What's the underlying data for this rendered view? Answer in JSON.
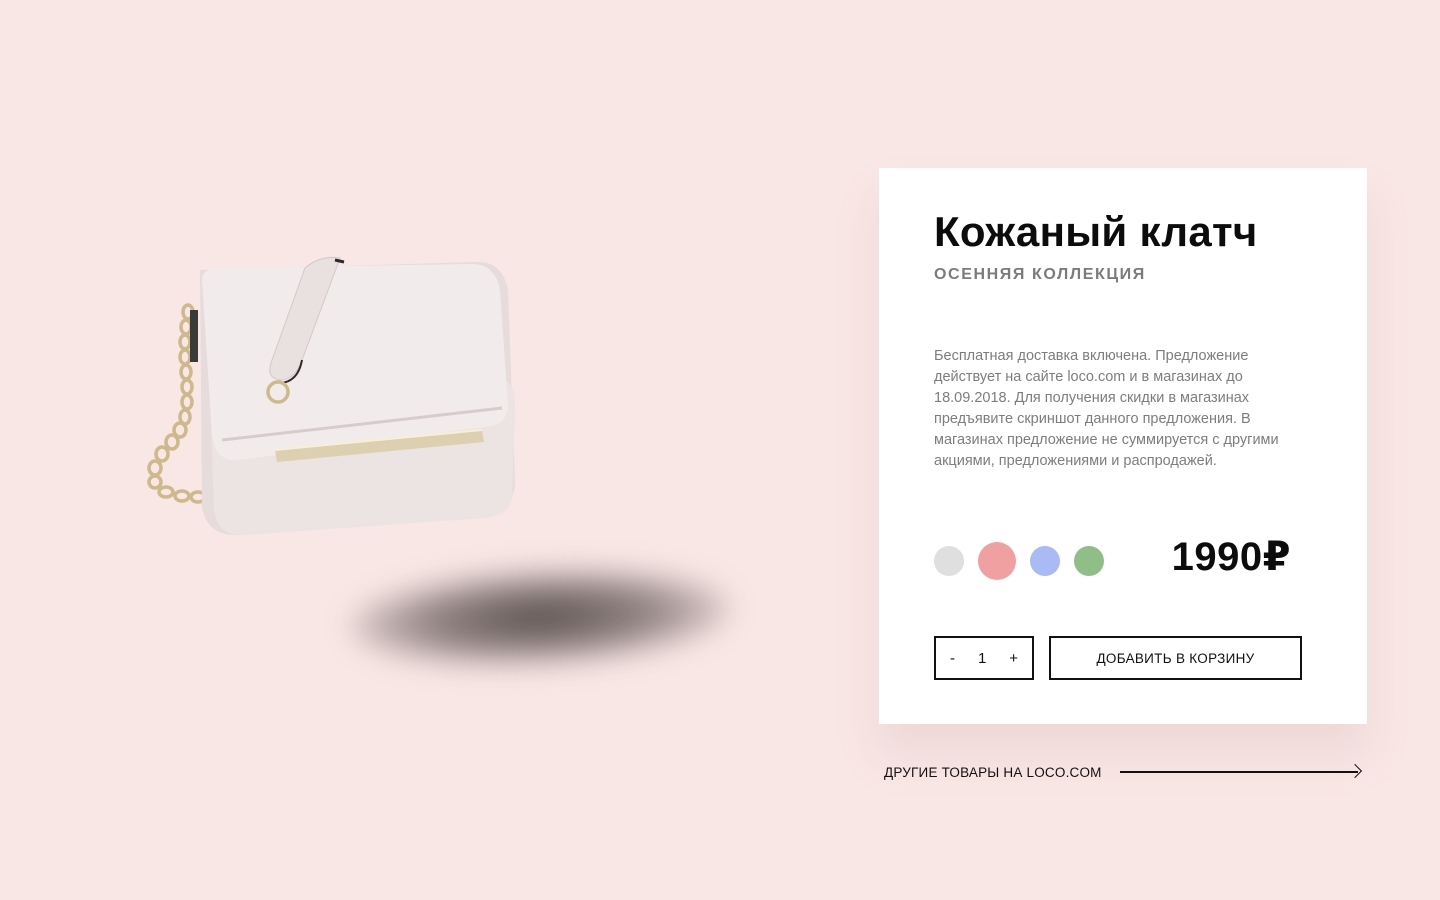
{
  "product": {
    "title": "Кожаный клатч",
    "subtitle": "ОСЕННЯЯ КОЛЛЕКЦИЯ",
    "description": "Бесплатная доставка включена. Предложение действует на сайте loco.com и в магазинах до 18.09.2018. Для получения скидки в магазинах предъявите скриншот данного предложения. В магазинах предложение не суммируется с другими акциями, предложениями и распродажей.",
    "price": "1990₽",
    "colors": [
      {
        "name": "grey",
        "hex": "#dfdfdf",
        "selected": false
      },
      {
        "name": "pink",
        "hex": "#f0a0a0",
        "selected": true
      },
      {
        "name": "blue",
        "hex": "#a9baf5",
        "selected": false
      },
      {
        "name": "green",
        "hex": "#8fbf86",
        "selected": false
      }
    ]
  },
  "quantity": {
    "minus": "-",
    "value": "1",
    "plus": "+"
  },
  "cart": {
    "add_label": "ДОБАВИТЬ В КОРЗИНУ"
  },
  "footer": {
    "more_link": "ДРУГИЕ ТОВАРЫ НА LOCO.COM",
    "arrow_icon": "arrow-right-icon"
  },
  "theme": {
    "background": "#f9e7e5",
    "card": "#ffffff",
    "text": "#0c0c0c",
    "muted": "#7d7d7d"
  }
}
